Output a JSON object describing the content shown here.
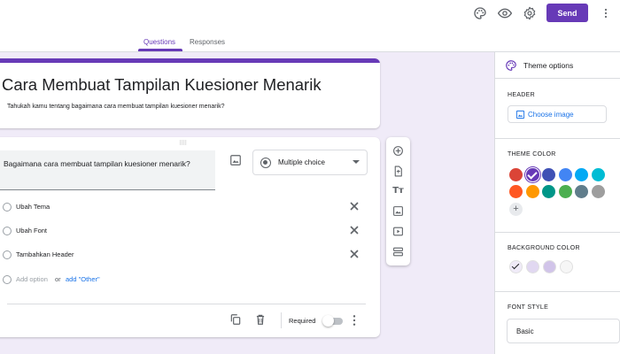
{
  "header": {
    "icons": [
      "palette-icon",
      "preview-eye-icon",
      "settings-gear-icon",
      "more-vert-icon"
    ],
    "send_label": "Send",
    "tabs": [
      {
        "label": "Questions",
        "active": true
      },
      {
        "label": "Responses",
        "active": false
      }
    ]
  },
  "form": {
    "title": "Cara Membuat Tampilan Kuesioner Menarik",
    "description": "Tahukah kamu tentang bagaimana cara membuat tampilan kuesioner menarik?"
  },
  "question": {
    "text": "Bagaimana cara membuat tampilan kuesioner menarik?",
    "type_label": "Multiple choice",
    "options": [
      "Ubah Tema",
      "Ubah Font",
      "Tambahkan Header"
    ],
    "add_option_label": "Add option",
    "or_label": "or",
    "add_other_label": "add \"Other\"",
    "required_label": "Required",
    "required_on": false
  },
  "toolbar": {
    "icons": [
      "add-question-icon",
      "import-questions-icon",
      "add-title-icon",
      "add-image-icon",
      "add-video-icon",
      "add-section-icon"
    ],
    "title_glyph": "Tт"
  },
  "theme_panel": {
    "title": "Theme options",
    "header_section": "HEADER",
    "choose_image_label": "Choose image",
    "theme_color_section": "THEME COLOR",
    "theme_colors": [
      "#db4437",
      "#673ab7",
      "#3f51b5",
      "#4285f4",
      "#03a9f4",
      "#00bcd4",
      "#ff5722",
      "#ff9800",
      "#009688",
      "#4caf50",
      "#607d8b",
      "#9e9e9e"
    ],
    "selected_theme_color": "#673ab7",
    "add_color_label": "+",
    "background_color_section": "BACKGROUND COLOR",
    "background_colors": [
      "#f0ebf8",
      "#e1d8f1",
      "#d1c4e9",
      "#f6f6f6"
    ],
    "selected_background_color": "#f0ebf8",
    "font_style_section": "FONT STYLE",
    "font_style_value": "Basic"
  },
  "colors": {
    "accent": "#673ab7",
    "link": "#1a73e8",
    "page_background": "#f0ebf8"
  }
}
